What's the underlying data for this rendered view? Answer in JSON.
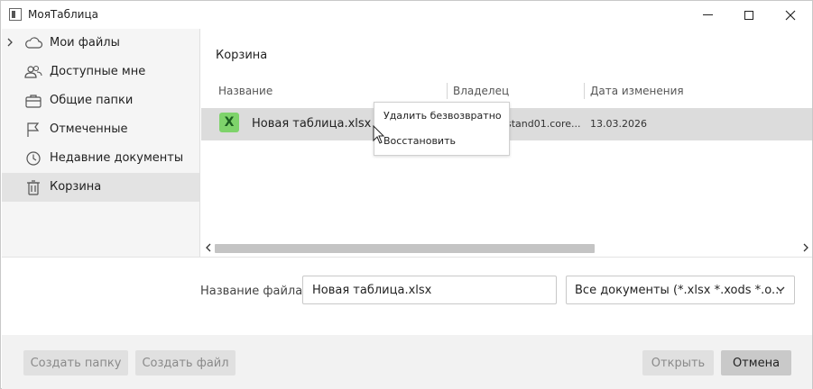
{
  "window": {
    "title": "МояТаблица"
  },
  "sidebar": {
    "items": [
      {
        "label": "Мои файлы",
        "icon": "cloud-icon",
        "expandable": true,
        "selected": false
      },
      {
        "label": "Доступные мне",
        "icon": "users-icon",
        "selected": false
      },
      {
        "label": "Общие папки",
        "icon": "briefcase-icon",
        "selected": false
      },
      {
        "label": "Отмеченные",
        "icon": "flag-icon",
        "selected": false
      },
      {
        "label": "Недавние документы",
        "icon": "clock-icon",
        "selected": false
      },
      {
        "label": "Корзина",
        "icon": "trash-icon",
        "selected": true
      }
    ]
  },
  "main": {
    "breadcrumb": "Корзина",
    "columns": [
      "Название",
      "Владелец",
      "Дата изменения"
    ],
    "rows": [
      {
        "name": "Новая таблица.xlsx",
        "icon_letter": "X",
        "owner": "stand01.core...",
        "date": "13.03.2026"
      }
    ]
  },
  "context_menu": {
    "items": [
      "Удалить безвозвратно",
      "Восстановить"
    ]
  },
  "filename": {
    "label": "Название файла",
    "value": "Новая таблица.xlsx"
  },
  "filetype": {
    "value": "Все документы (*.xlsx *.xods *.o..."
  },
  "footer": {
    "create_folder": "Создать папку",
    "create_file": "Создать файл",
    "open": "Открыть",
    "cancel": "Отмена"
  },
  "colors": {
    "sidebar_bg": "#f5f5f5",
    "selected_bg": "#e3e3e3",
    "row_selected_bg": "#dcdcdc",
    "xlsx_icon": "#7ed36b"
  }
}
